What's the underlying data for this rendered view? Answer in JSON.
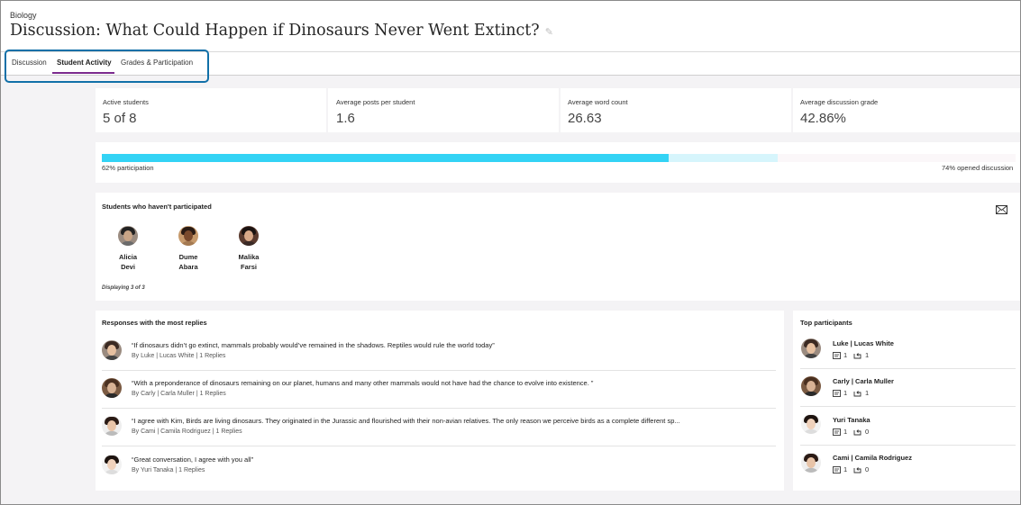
{
  "header": {
    "course": "Biology",
    "title": "Discussion: What Could Happen if Dinosaurs Never Went Extinct?"
  },
  "tabs": [
    {
      "label": "Discussion",
      "active": false
    },
    {
      "label": "Student Activity",
      "active": true
    },
    {
      "label": "Grades & Participation",
      "active": false
    }
  ],
  "stats": [
    {
      "label": "Active students",
      "value": "5 of 8"
    },
    {
      "label": "Average posts per student",
      "value": "1.6"
    },
    {
      "label": "Average word count",
      "value": "26.63"
    },
    {
      "label": "Average discussion grade",
      "value": "42.86%"
    }
  ],
  "participation": {
    "participation_fraction": 0.62,
    "opened_fraction": 0.74,
    "participation_label": "62% participation",
    "opened_label": "74% opened discussion"
  },
  "not_participated": {
    "title": "Students who haven't participated",
    "students": [
      {
        "first": "Alicia",
        "last": "Devi"
      },
      {
        "first": "Dume",
        "last": "Abara"
      },
      {
        "first": "Malika",
        "last": "Farsi"
      }
    ],
    "displaying": "Displaying 3 of 3",
    "mail_icon": "envelope-icon"
  },
  "responses": {
    "title": "Responses with the most replies",
    "items": [
      {
        "text": "“If dinosaurs didn’t go extinct, mammals probably would’ve remained in the shadows. Reptiles would rule the world today”",
        "meta": "By Luke  |  Lucas White  |  1 Replies"
      },
      {
        "text": "“With a preponderance of dinosaurs remaining on our planet, humans and many other mammals would not have had the chance to evolve into existence. ”",
        "meta": "By Carly  |  Carla Muller  |  1 Replies"
      },
      {
        "text": "“I agree with Kim, Birds are living dinosaurs. They originated in the Jurassic and flourished with their non-avian relatives. The only reason we perceive birds as a complete different sp...",
        "meta": "By Cami  |  Camila Rodriguez  |  1 Replies"
      },
      {
        "text": "“Great conversation, I agree with you all”",
        "meta": "By Yuri Tanaka  |  1 Replies"
      }
    ]
  },
  "top_participants": {
    "title": "Top participants",
    "items": [
      {
        "name": "Luke  |  Lucas White",
        "posts": "1",
        "replies": "1"
      },
      {
        "name": "Carly  |  Carla Muller",
        "posts": "1",
        "replies": "1"
      },
      {
        "name": "Yuri Tanaka",
        "posts": "1",
        "replies": "0"
      },
      {
        "name": "Cami  |  Camila Rodriguez",
        "posts": "1",
        "replies": "0"
      }
    ]
  }
}
